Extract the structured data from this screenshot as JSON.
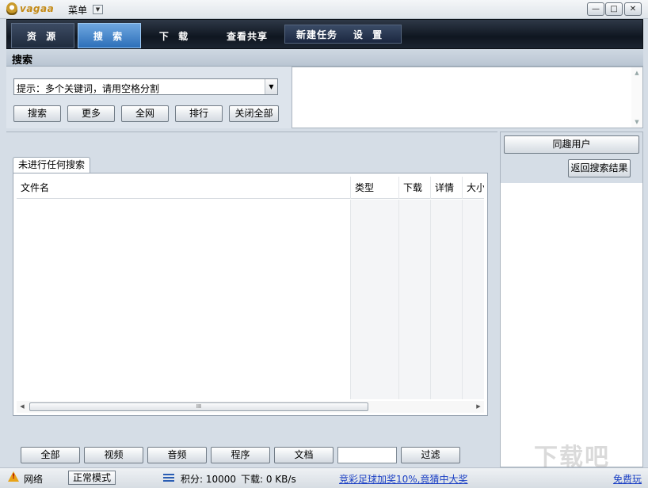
{
  "app": {
    "logo_text": "vagaa",
    "menu_label": "菜单"
  },
  "window_buttons": {
    "minimize": "—",
    "maximize": "□",
    "close": "✕"
  },
  "nav": {
    "tabs": [
      {
        "label": "资 源"
      },
      {
        "label": "搜 索",
        "active": true
      },
      {
        "label": "下 载"
      },
      {
        "label": "查看共享"
      }
    ],
    "new_task": "新建任务",
    "settings": "设 置"
  },
  "section_title": "搜索",
  "search": {
    "combo_value": "提示：多个关键词，请用空格分割",
    "buttons": [
      "搜索",
      "更多",
      "全网",
      "排行",
      "关闭全部"
    ]
  },
  "results": {
    "tab_label": "未进行任何搜索",
    "columns": [
      "文件名",
      "类型",
      "下载",
      "详情",
      "大小"
    ],
    "scroll_grip": "III"
  },
  "filters": {
    "buttons": [
      "全部",
      "视频",
      "音频",
      "程序",
      "文档"
    ],
    "filter_button": "过滤",
    "filter_input_value": ""
  },
  "right_panel": {
    "similar_users": "同趣用户",
    "back_to_results": "返回搜索结果"
  },
  "status": {
    "network": "网络",
    "mode": "正常模式",
    "points": "积分: 10000",
    "download": "下载: 0 KB/s",
    "promo": "竞彩足球加奖10%,竟猜中大奖",
    "free_play": "免费玩"
  },
  "watermark": "下载吧",
  "colors": {
    "active_tab": "#2c6fb9",
    "nav_bg": "#0f1620",
    "link": "#1a3fc4",
    "warning": "#e8a317"
  }
}
